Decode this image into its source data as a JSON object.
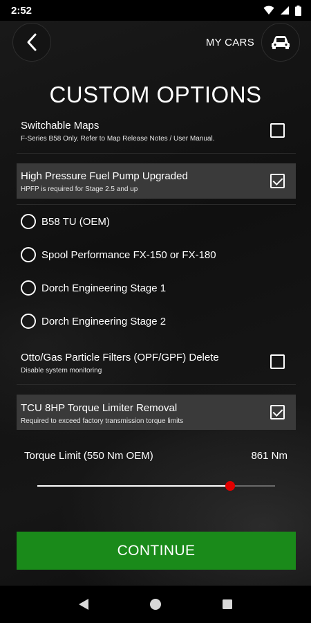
{
  "status_bar": {
    "time": "2:52"
  },
  "header": {
    "my_cars_label": "MY CARS"
  },
  "page": {
    "title": "CUSTOM OPTIONS"
  },
  "options": {
    "switchable_maps": {
      "title": "Switchable Maps",
      "subtitle": "F-Series B58 Only. Refer to Map Release Notes / User Manual.",
      "checked": false
    },
    "hpfp": {
      "title": "High Pressure Fuel Pump Upgraded",
      "subtitle": "HPFP is required for Stage 2.5 and up",
      "checked": true
    },
    "pump_choices": [
      {
        "label": "B58 TU (OEM)",
        "selected": false
      },
      {
        "label": "Spool Performance FX-150 or FX-180",
        "selected": false
      },
      {
        "label": "Dorch Engineering Stage 1",
        "selected": false
      },
      {
        "label": "Dorch Engineering Stage 2",
        "selected": false
      }
    ],
    "opf_delete": {
      "title": "Otto/Gas Particle Filters (OPF/GPF) Delete",
      "subtitle": "Disable system monitoring",
      "checked": false
    },
    "tcu_limiter": {
      "title": "TCU 8HP Torque Limiter Removal",
      "subtitle": "Required to exceed factory transmission torque limits",
      "checked": true
    }
  },
  "torque": {
    "label": "Torque Limit (550 Nm OEM)",
    "value_text": "861 Nm",
    "slider_fraction": 0.81,
    "thumb_color": "#e10000"
  },
  "continue_label": "CONTINUE",
  "colors": {
    "accent_green": "#1a8a1a",
    "highlight_row": "#3a3a3a"
  }
}
